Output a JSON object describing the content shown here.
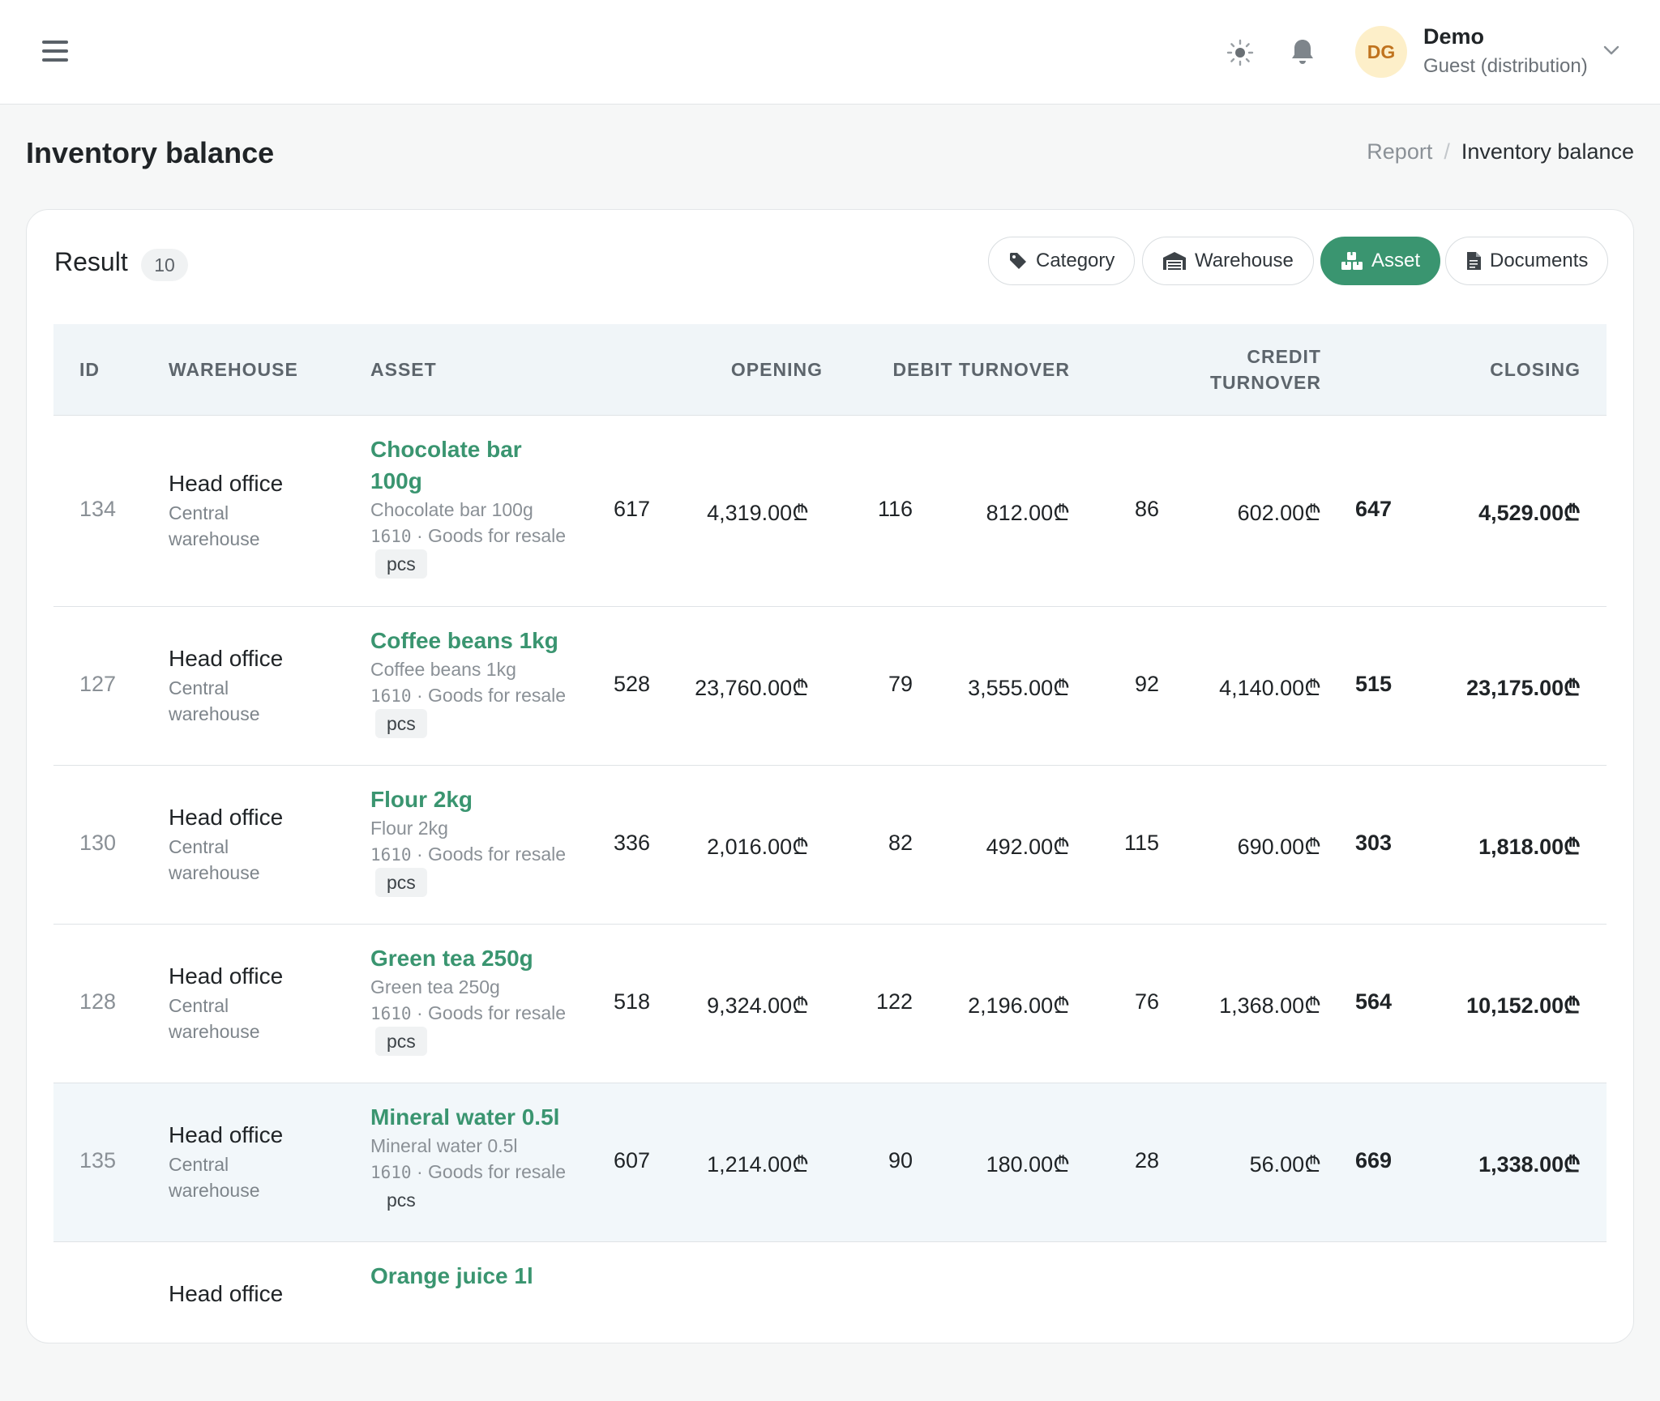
{
  "topbar": {
    "user": {
      "initials": "DG",
      "name": "Demo",
      "role": "Guest (distribution)"
    }
  },
  "page": {
    "title": "Inventory balance",
    "breadcrumb": {
      "parent": "Report",
      "separator": "/",
      "current": "Inventory balance"
    }
  },
  "result": {
    "label": "Result",
    "count": "10"
  },
  "group_buttons": [
    {
      "label": "Category",
      "icon": "tag-icon",
      "active": false
    },
    {
      "label": "Warehouse",
      "icon": "warehouse-icon",
      "active": false
    },
    {
      "label": "Asset",
      "icon": "boxes-icon",
      "active": true
    },
    {
      "label": "Documents",
      "icon": "document-icon",
      "active": false
    }
  ],
  "table": {
    "headers": {
      "id": "ID",
      "warehouse": "WAREHOUSE",
      "asset": "ASSET",
      "opening": "OPENING",
      "debit": "DEBIT TURNOVER",
      "credit_1": "CREDIT",
      "credit_2": "TURNOVER",
      "closing": "CLOSING"
    },
    "rows": [
      {
        "id": "134",
        "wh": "Head office",
        "wh_sub": "Central warehouse",
        "asset": "Chocolate bar 100g",
        "asset_sub": "Chocolate bar 100g",
        "code": "1610",
        "category": " · Goods for resale",
        "unit": "pcs",
        "open_q": "617",
        "open_v": "4,319.00₾",
        "deb_q": "116",
        "deb_v": "812.00₾",
        "cred_q": "86",
        "cred_v": "602.00₾",
        "close_q": "647",
        "close_v": "4,529.00₾"
      },
      {
        "id": "127",
        "wh": "Head office",
        "wh_sub": "Central warehouse",
        "asset": "Coffee beans 1kg",
        "asset_sub": "Coffee beans 1kg",
        "code": "1610",
        "category": " · Goods for resale",
        "unit": "pcs",
        "open_q": "528",
        "open_v": "23,760.00₾",
        "deb_q": "79",
        "deb_v": "3,555.00₾",
        "cred_q": "92",
        "cred_v": "4,140.00₾",
        "close_q": "515",
        "close_v": "23,175.00₾"
      },
      {
        "id": "130",
        "wh": "Head office",
        "wh_sub": "Central warehouse",
        "asset": "Flour 2kg",
        "asset_sub": "Flour 2kg",
        "code": "1610",
        "category": " · Goods for resale",
        "unit": "pcs",
        "open_q": "336",
        "open_v": "2,016.00₾",
        "deb_q": "82",
        "deb_v": "492.00₾",
        "cred_q": "115",
        "cred_v": "690.00₾",
        "close_q": "303",
        "close_v": "1,818.00₾"
      },
      {
        "id": "128",
        "wh": "Head office",
        "wh_sub": "Central warehouse",
        "asset": "Green tea 250g",
        "asset_sub": "Green tea 250g",
        "code": "1610",
        "category": " · Goods for resale",
        "unit": "pcs",
        "open_q": "518",
        "open_v": "9,324.00₾",
        "deb_q": "122",
        "deb_v": "2,196.00₾",
        "cred_q": "76",
        "cred_v": "1,368.00₾",
        "close_q": "564",
        "close_v": "10,152.00₾"
      },
      {
        "id": "135",
        "wh": "Head office",
        "wh_sub": "Central warehouse",
        "asset": "Mineral water 0.5l",
        "asset_sub": "Mineral water 0.5l",
        "code": "1610",
        "category": " · Goods for resale",
        "unit": "pcs",
        "open_q": "607",
        "open_v": "1,214.00₾",
        "deb_q": "90",
        "deb_v": "180.00₾",
        "cred_q": "28",
        "cred_v": "56.00₾",
        "close_q": "669",
        "close_v": "1,338.00₾"
      },
      {
        "wh": "Head office",
        "asset": "Orange juice 1l"
      }
    ]
  }
}
